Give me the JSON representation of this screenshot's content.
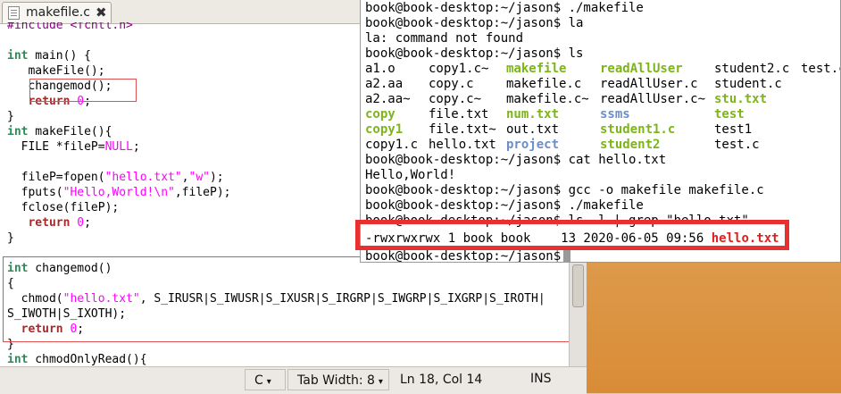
{
  "editor": {
    "tab": {
      "title": "makefile.c",
      "close": "✖"
    },
    "code_lines": [
      {
        "parts": [
          {
            "t": "#include <fcntl.h>",
            "c": "pp"
          }
        ]
      },
      {
        "parts": [
          {
            "t": "",
            "c": ""
          }
        ]
      },
      {
        "parts": [
          {
            "t": "int",
            "c": "ty"
          },
          {
            "t": " main() {",
            "c": ""
          }
        ]
      },
      {
        "parts": [
          {
            "t": "   makeFile();",
            "c": ""
          }
        ]
      },
      {
        "parts": [
          {
            "t": "   changemod();",
            "c": ""
          }
        ]
      },
      {
        "parts": [
          {
            "t": "   ",
            "c": ""
          },
          {
            "t": "return",
            "c": "kw"
          },
          {
            "t": " ",
            "c": ""
          },
          {
            "t": "0",
            "c": "st"
          },
          {
            "t": ";",
            "c": ""
          }
        ]
      },
      {
        "parts": [
          {
            "t": "}",
            "c": ""
          }
        ]
      },
      {
        "parts": [
          {
            "t": "int",
            "c": "ty"
          },
          {
            "t": " makeFile(){",
            "c": ""
          }
        ]
      },
      {
        "parts": [
          {
            "t": "  FILE *fileP=",
            "c": ""
          },
          {
            "t": "NULL",
            "c": "st"
          },
          {
            "t": ";",
            "c": ""
          }
        ]
      },
      {
        "parts": [
          {
            "t": "",
            "c": ""
          }
        ]
      },
      {
        "parts": [
          {
            "t": "  fileP=fopen(",
            "c": ""
          },
          {
            "t": "\"hello.txt\"",
            "c": "st"
          },
          {
            "t": ",",
            "c": ""
          },
          {
            "t": "\"w\"",
            "c": "st"
          },
          {
            "t": ");",
            "c": ""
          }
        ]
      },
      {
        "parts": [
          {
            "t": "  fputs(",
            "c": ""
          },
          {
            "t": "\"Hello,World!\\n\"",
            "c": "st"
          },
          {
            "t": ",fileP);",
            "c": ""
          }
        ]
      },
      {
        "parts": [
          {
            "t": "  fclose(fileP);",
            "c": ""
          }
        ]
      },
      {
        "parts": [
          {
            "t": "   ",
            "c": ""
          },
          {
            "t": "return",
            "c": "kw"
          },
          {
            "t": " ",
            "c": ""
          },
          {
            "t": "0",
            "c": "st"
          },
          {
            "t": ";",
            "c": ""
          }
        ]
      },
      {
        "parts": [
          {
            "t": "}",
            "c": ""
          }
        ]
      },
      {
        "parts": [
          {
            "t": "",
            "c": ""
          }
        ]
      },
      {
        "parts": [
          {
            "t": "int",
            "c": "ty"
          },
          {
            "t": " changemod()",
            "c": ""
          }
        ]
      },
      {
        "parts": [
          {
            "t": "{",
            "c": ""
          }
        ]
      },
      {
        "parts": [
          {
            "t": "  chmod(",
            "c": ""
          },
          {
            "t": "\"hello.txt\"",
            "c": "st"
          },
          {
            "t": ", S_IRUSR|S_IWUSR|S_IXUSR|S_IRGRP|S_IWGRP|S_IXGRP|S_IROTH|",
            "c": ""
          }
        ]
      },
      {
        "parts": [
          {
            "t": "S_IWOTH|S_IXOTH);",
            "c": ""
          }
        ]
      },
      {
        "parts": [
          {
            "t": "  ",
            "c": ""
          },
          {
            "t": "return",
            "c": "kw"
          },
          {
            "t": " ",
            "c": ""
          },
          {
            "t": "0",
            "c": "st"
          },
          {
            "t": ";",
            "c": ""
          }
        ]
      },
      {
        "parts": [
          {
            "t": "}",
            "c": ""
          }
        ]
      },
      {
        "parts": [
          {
            "t": "int",
            "c": "ty"
          },
          {
            "t": " chmodOnlyRead(){",
            "c": ""
          }
        ]
      }
    ],
    "statusbar": {
      "language": "C",
      "tab_width_label": "Tab Width:",
      "tab_width_value": "8",
      "position": "Ln 18, Col 14",
      "mode": "INS"
    }
  },
  "terminal": {
    "lines": [
      "book@book-desktop:~/jason$ ./makefile",
      "book@book-desktop:~/jason$ la",
      "la: command not found",
      "book@book-desktop:~/jason$ ls"
    ],
    "ls_rows": [
      [
        {
          "t": "a1.o",
          "c": "reg"
        },
        {
          "t": "copy1.c~",
          "c": "reg"
        },
        {
          "t": "makefile",
          "c": "exe"
        },
        {
          "t": "readAllUser",
          "c": "exe"
        },
        {
          "t": "student2.c",
          "c": "reg"
        },
        {
          "t": "test.c",
          "c": "reg"
        }
      ],
      [
        {
          "t": "a2.aa",
          "c": "reg"
        },
        {
          "t": "copy.c",
          "c": "reg"
        },
        {
          "t": "makefile.c",
          "c": "reg"
        },
        {
          "t": "readAllUser.c",
          "c": "reg"
        },
        {
          "t": "student.c",
          "c": "reg"
        }
      ],
      [
        {
          "t": "a2.aa~",
          "c": "reg"
        },
        {
          "t": "copy.c~",
          "c": "reg"
        },
        {
          "t": "makefile.c~",
          "c": "reg"
        },
        {
          "t": "readAllUser.c~",
          "c": "reg"
        },
        {
          "t": "stu.txt",
          "c": "exe"
        }
      ],
      [
        {
          "t": "copy",
          "c": "exe"
        },
        {
          "t": "file.txt",
          "c": "reg"
        },
        {
          "t": "num.txt",
          "c": "exe"
        },
        {
          "t": "ssms",
          "c": "dir"
        },
        {
          "t": "test",
          "c": "exe"
        }
      ],
      [
        {
          "t": "copy1",
          "c": "exe"
        },
        {
          "t": "file.txt~",
          "c": "reg"
        },
        {
          "t": "out.txt",
          "c": "reg"
        },
        {
          "t": "student1.c",
          "c": "exe"
        },
        {
          "t": "test1",
          "c": "reg"
        }
      ],
      [
        {
          "t": "copy1.c",
          "c": "reg"
        },
        {
          "t": "hello.txt",
          "c": "reg"
        },
        {
          "t": "project",
          "c": "dir"
        },
        {
          "t": "student2",
          "c": "exe"
        },
        {
          "t": "test.c",
          "c": "reg"
        }
      ]
    ],
    "after_lines": [
      "book@book-desktop:~/jason$ cat hello.txt",
      "Hello,World!",
      "book@book-desktop:~/jason$ gcc -o makefile makefile.c",
      "book@book-desktop:~/jason$ ./makefile",
      "book@book-desktop:~/jason$ ls -l | grep \"hello.txt\""
    ],
    "highlight_line": {
      "prefix": "-rwxrwxrwx 1 book book    13 2020-06-05 09:56 ",
      "file": "hello.txt"
    },
    "prompt_line": "book@book-desktop:~/jason$",
    "colors": {
      "exe": "#7cb518",
      "dir": "#6c8ec9",
      "highlight": "#e02020",
      "annotation": "#e83030"
    }
  }
}
